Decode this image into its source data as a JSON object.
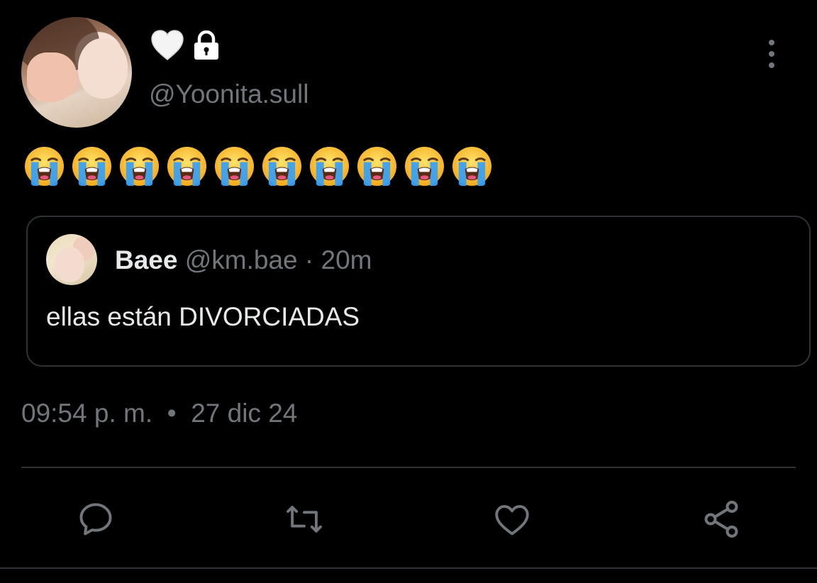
{
  "author": {
    "badges": [
      "white-heart-icon",
      "lock-icon"
    ],
    "handle": "@Yoonita.sull"
  },
  "tweet": {
    "emoji_text": "😭😭😭😭😭😭😭😭😭😭",
    "emoji_count": 10
  },
  "quoted_tweet": {
    "name": "Baee",
    "handle": "@km.bae",
    "separator": " · ",
    "time": "20m",
    "text": "ellas están DIVORCIADAS"
  },
  "meta": {
    "time": "09:54 p. m.",
    "separator": "  •  ",
    "date": "27 dic 24"
  },
  "actions": [
    "reply-icon",
    "retweet-icon",
    "like-icon",
    "share-icon"
  ],
  "colors": {
    "background": "#000000",
    "text": "#e7e9ea",
    "muted": "#71767b",
    "border": "#2f3336"
  }
}
